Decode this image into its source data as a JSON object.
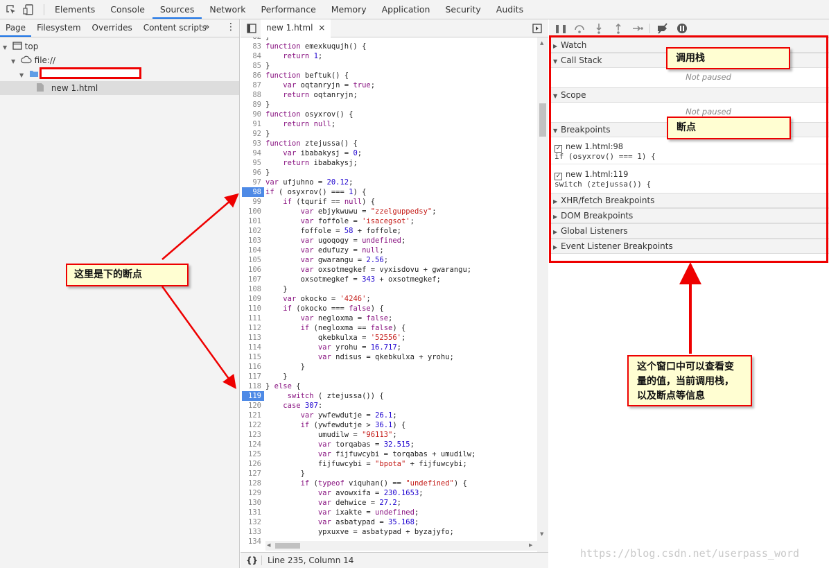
{
  "main_tabs": [
    "Elements",
    "Console",
    "Sources",
    "Network",
    "Performance",
    "Memory",
    "Application",
    "Security",
    "Audits"
  ],
  "active_main_tab": "Sources",
  "navigator": {
    "tabs": [
      "Page",
      "Filesystem",
      "Overrides",
      "Content scripts"
    ],
    "more": "»",
    "tree": {
      "top": "top",
      "origin": "file://",
      "file": "new 1.html"
    }
  },
  "editor": {
    "file_tab": "new 1.html",
    "close": "×",
    "status": "Line 235, Column 14",
    "pretty": "{}",
    "lines": [
      {
        "n": "82",
        "c": "}"
      },
      {
        "n": "83",
        "c": "function emexkuqujh() {"
      },
      {
        "n": "84",
        "c": "    return 1;"
      },
      {
        "n": "85",
        "c": "}"
      },
      {
        "n": "86",
        "c": "function beftuk() {"
      },
      {
        "n": "87",
        "c": "    var oqtanryjn = true;"
      },
      {
        "n": "88",
        "c": "    return oqtanryjn;"
      },
      {
        "n": "89",
        "c": "}"
      },
      {
        "n": "90",
        "c": "function osyxrov() {"
      },
      {
        "n": "91",
        "c": "    return null;"
      },
      {
        "n": "92",
        "c": "}"
      },
      {
        "n": "93",
        "c": "function ztejussa() {"
      },
      {
        "n": "94",
        "c": "    var ibabakysj = 0;"
      },
      {
        "n": "95",
        "c": "    return ibabakysj;"
      },
      {
        "n": "96",
        "c": "}"
      },
      {
        "n": "97",
        "c": "var ufjuhno = 20.12;"
      },
      {
        "n": "98",
        "c": "if ( osyxrov() === 1) {",
        "bp": true
      },
      {
        "n": "99",
        "c": "    if (tqurif == null) {"
      },
      {
        "n": "100",
        "c": "        var ebjykwuwu = \"zzelguppedsy\";"
      },
      {
        "n": "101",
        "c": "        var foffole = 'isacegsot';"
      },
      {
        "n": "102",
        "c": "        foffole = 58 + foffole;"
      },
      {
        "n": "103",
        "c": "        var ugoqogy = undefined;"
      },
      {
        "n": "104",
        "c": "        var edufuzy = null;"
      },
      {
        "n": "105",
        "c": "        var gwarangu = 2.56;"
      },
      {
        "n": "106",
        "c": "        var oxsotmegkef = vyxisdovu + gwarangu;"
      },
      {
        "n": "107",
        "c": "        oxsotmegkef = 343 + oxsotmegkef;"
      },
      {
        "n": "108",
        "c": "    }"
      },
      {
        "n": "109",
        "c": "    var okocko = '4246';"
      },
      {
        "n": "110",
        "c": "    if (okocko === false) {"
      },
      {
        "n": "111",
        "c": "        var negloxma = false;"
      },
      {
        "n": "112",
        "c": "        if (negloxma == false) {"
      },
      {
        "n": "113",
        "c": "            qkebkulxa = '52556';"
      },
      {
        "n": "114",
        "c": "            var yrohu = 16.717;"
      },
      {
        "n": "115",
        "c": "            var ndisus = qkebkulxa + yrohu;"
      },
      {
        "n": "116",
        "c": "        }"
      },
      {
        "n": "117",
        "c": "    }"
      },
      {
        "n": "118",
        "c": "} else {"
      },
      {
        "n": "119",
        "c": "     switch ( ztejussa()) {",
        "bp": true
      },
      {
        "n": "120",
        "c": "    case 307:"
      },
      {
        "n": "121",
        "c": "        var ywfewdutje = 26.1;"
      },
      {
        "n": "122",
        "c": "        if (ywfewdutje > 36.1) {"
      },
      {
        "n": "123",
        "c": "            umudilw = \"96113\";"
      },
      {
        "n": "124",
        "c": "            var torqabas = 32.515;"
      },
      {
        "n": "125",
        "c": "            var fijfuwcybi = torqabas + umudilw;"
      },
      {
        "n": "126",
        "c": "            fijfuwcybi = \"bpota\" + fijfuwcybi;"
      },
      {
        "n": "127",
        "c": "        }"
      },
      {
        "n": "128",
        "c": "        if (typeof viquhan() == \"undefined\") {"
      },
      {
        "n": "129",
        "c": "            var avowxifa = 230.1653;"
      },
      {
        "n": "130",
        "c": "            var dehwice = 27.2;"
      },
      {
        "n": "131",
        "c": "            var ixakte = undefined;"
      },
      {
        "n": "132",
        "c": "            var asbatypad = 35.168;"
      },
      {
        "n": "133",
        "c": "            ypxuxve = asbatypad + byzajyfo;"
      },
      {
        "n": "134",
        "c": ""
      }
    ]
  },
  "debugger": {
    "sections": {
      "watch": "Watch",
      "call_stack": "Call Stack",
      "scope": "Scope",
      "breakpoints": "Breakpoints",
      "xhr": "XHR/fetch Breakpoints",
      "dom": "DOM Breakpoints",
      "global": "Global Listeners",
      "event": "Event Listener Breakpoints"
    },
    "not_paused": "Not paused",
    "breakpoints": [
      {
        "label": "new 1.html:98",
        "code": "if (osyxrov() === 1) {"
      },
      {
        "label": "new 1.html:119",
        "code": "switch (ztejussa()) {"
      }
    ]
  },
  "annotations": {
    "call_stack_note": "调用栈",
    "breakpoints_note": "断点",
    "left_note": "这里是下的断点",
    "panel_note": "这个窗口中可以查看变量的值，当前调用栈，以及断点等信息"
  },
  "watermark": "https://blog.csdn.net/userpass_word",
  "colors": {
    "breakpoint": "#4e8ae6",
    "annotation_border": "#e00000",
    "note_bg": "#fffed2",
    "active_tab": "#1a73e8"
  }
}
